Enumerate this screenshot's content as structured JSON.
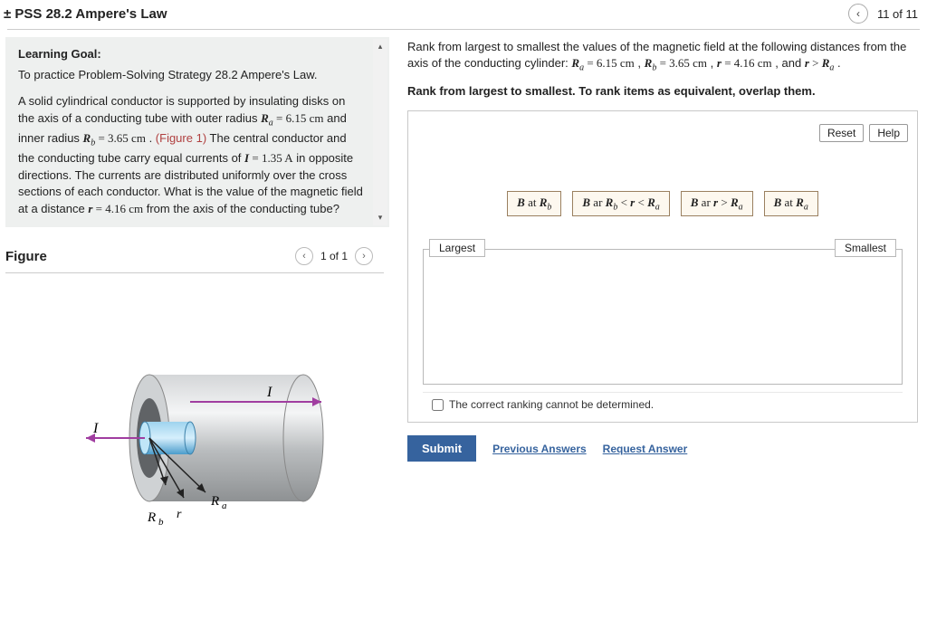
{
  "header": {
    "title": "± PSS 28.2 Ampere's Law",
    "counter": "11 of 11"
  },
  "learning": {
    "heading": "Learning Goal:",
    "goal": "To practice Problem-Solving Strategy 28.2 Ampere's Law.",
    "body_pre": "A solid cylindrical conductor is supported by insulating disks on the axis of a conducting tube with outer radius ",
    "Ra_eq": "Rₐ = 6.15 cm",
    "body_mid1": " and inner radius ",
    "Rb_eq": "R_b = 3.65 cm",
    "body_mid2": " . ",
    "fig_link": "(Figure 1)",
    "body_mid3": " The central conductor and the conducting tube carry equal currents of ",
    "I_eq": "I = 1.35 A",
    "body_mid4": " in opposite directions. The currents are distributed uniformly over the cross sections of each conductor. What is the value of the magnetic field at a distance ",
    "r_eq": "r = 4.16 cm",
    "body_end": " from the axis of the conducting tube?"
  },
  "figure": {
    "title": "Figure",
    "counter": "1 of 1",
    "labels": {
      "I1": "I",
      "I2": "I",
      "Ra": "Rₐ",
      "Rb": "R_b",
      "r": "r"
    }
  },
  "question": {
    "line1_pre": "Rank from largest to smallest the values of the magnetic field at the following distances from the axis of the conducting cylinder: ",
    "Ra": "Rₐ = 6.15 cm",
    "sep1": " , ",
    "Rb": "R_b = 3.65 cm",
    "sep2": " , ",
    "r": "r = 4.16 cm",
    "sep3": " , and ",
    "cond": "r > Rₐ",
    "end": ".",
    "instruction": "Rank from largest to smallest. To rank items as equivalent, overlap them."
  },
  "rank": {
    "reset": "Reset",
    "help": "Help",
    "chips": [
      "B at R_b",
      "B ar R_b < r < Rₐ",
      "B ar r > Rₐ",
      "B at Rₐ"
    ],
    "largest": "Largest",
    "smallest": "Smallest",
    "cannot": "The correct ranking cannot be determined."
  },
  "actions": {
    "submit": "Submit",
    "prev": "Previous Answers",
    "req": "Request Answer"
  }
}
